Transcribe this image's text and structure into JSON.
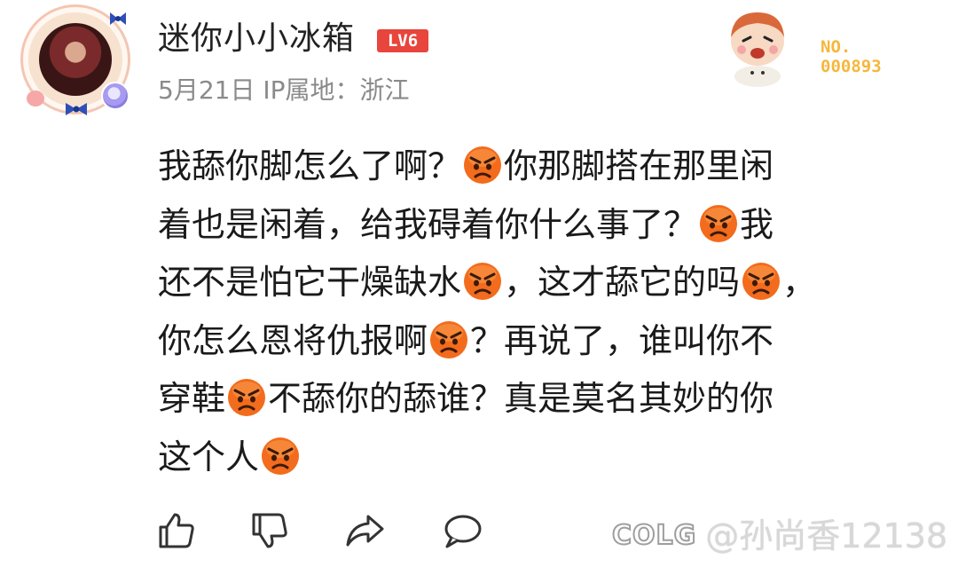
{
  "post": {
    "username": "迷你小小冰箱",
    "level_badge": "LV6",
    "meta": "5月21日 IP属地：浙江",
    "fan_number_label": "NO.",
    "fan_number": "000893",
    "content_lines": [
      [
        "我舔你脚怎么了啊？",
        "emoji",
        "你那脚搭在那里闲"
      ],
      [
        "着也是闲着，给我碍着你什么事了？",
        "emoji",
        "我"
      ],
      [
        "还不是怕它干燥缺水",
        "emoji",
        "，这才舔它的吗",
        "emoji",
        "，"
      ],
      [
        "你怎么恩将仇报啊",
        "emoji",
        "？再说了，谁叫你不"
      ],
      [
        "穿鞋",
        "emoji",
        "不舔你的舔谁？真是莫名其妙的你"
      ],
      [
        "这个人",
        "emoji"
      ]
    ],
    "emoji_icon": "angry-face-icon"
  },
  "actions": {
    "like_icon": "thumbs-up-icon",
    "dislike_icon": "thumbs-down-icon",
    "share_icon": "share-icon",
    "comment_icon": "comment-icon"
  },
  "watermark": {
    "logo": "COLG",
    "text": "@孙尚香12138"
  },
  "colors": {
    "level_badge": "#e8453c",
    "meta_text": "#8a8a8a",
    "fan_number": "#f6b73c",
    "emoji": "#f36b1c"
  }
}
